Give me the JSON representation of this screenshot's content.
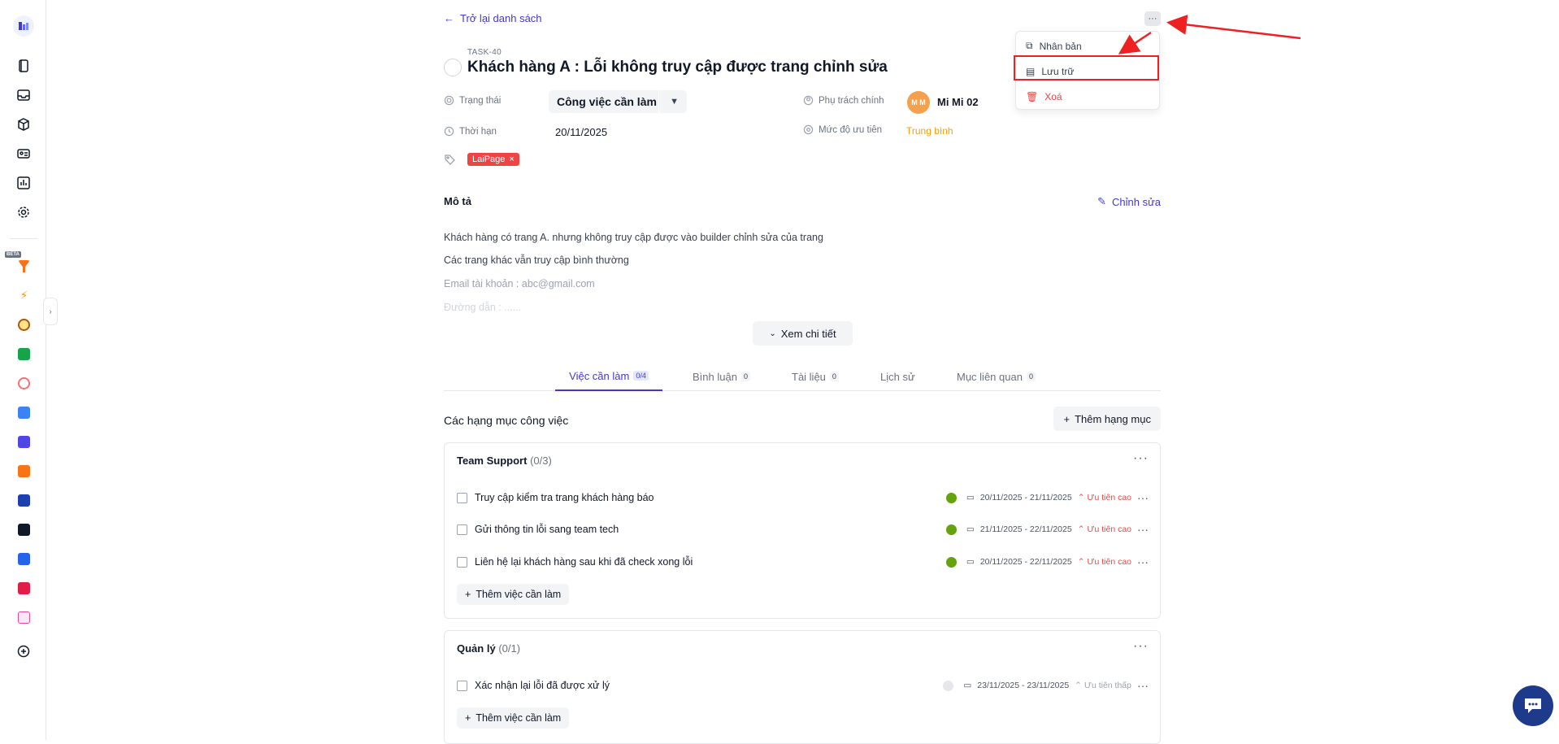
{
  "nav": {
    "back_label": "Trở lại danh sách"
  },
  "task": {
    "code": "TASK-40",
    "title": "Khách hàng A : Lỗi không truy cập được trang chỉnh sửa",
    "status_label": "Trạng thái",
    "status_value": "Công việc cần làm",
    "deadline_label": "Thời hạn",
    "deadline_value": "20/11/2025",
    "assignee_label": "Phụ trách chính",
    "assignee_initials": "M M",
    "assignee_name": "Mi Mi 02",
    "priority_label": "Mức độ ưu tiên",
    "priority_value": "Trung bình",
    "tag": "LaiPage",
    "tag_remove": "×"
  },
  "description": {
    "title": "Mô tả",
    "edit_label": "Chỉnh sửa",
    "lines": [
      "Khách hàng có trang A. nhưng không truy cập được vào builder chỉnh sửa của trang",
      "Các trang khác vẫn truy cập bình thường",
      "Email tài khoản : abc@gmail.com",
      "Đường dẫn : ......"
    ],
    "see_more": "Xem chi tiết"
  },
  "tabs": [
    {
      "label": "Việc cần làm",
      "count": "0/4"
    },
    {
      "label": "Bình luận",
      "count": "0"
    },
    {
      "label": "Tài liệu",
      "count": "0"
    },
    {
      "label": "Lịch sử",
      "count": ""
    },
    {
      "label": "Mục liên quan",
      "count": "0"
    }
  ],
  "checklist": {
    "title": "Các hạng mục công việc",
    "add_category": "Thêm hạng mục",
    "add_todo": "Thêm việc cần làm",
    "groups": [
      {
        "name": "Team Support",
        "count": "(0/3)",
        "items": [
          {
            "text": "Truy cập kiểm tra trang khách hàng báo",
            "dates": "20/11/2025 - 21/11/2025",
            "priority": "Ưu tiên cao"
          },
          {
            "text": "Gửi thông tin lỗi sang team tech",
            "dates": "21/11/2025 - 22/11/2025",
            "priority": "Ưu tiên cao"
          },
          {
            "text": "Liên hệ lại khách hàng sau khi đã check xong lỗi",
            "dates": "20/11/2025 - 22/11/2025",
            "priority": "Ưu tiên cao"
          }
        ]
      },
      {
        "name": "Quản lý",
        "count": "(0/1)",
        "items": [
          {
            "text": "Xác nhận lại lỗi đã được xử lý",
            "dates": "23/11/2025 - 23/11/2025",
            "priority": "Ưu tiên thấp"
          }
        ]
      }
    ]
  },
  "menu": {
    "more_label": "···",
    "duplicate": "Nhân bản",
    "archive": "Lưu trữ",
    "delete": "Xoá"
  },
  "sidebar": {
    "beta": "BETA",
    "collapse": "›"
  },
  "colors": {
    "accent": "#4338ca",
    "danger": "#ef4444",
    "priority_medium": "#f59e0b",
    "annotation": "#ef2020"
  }
}
